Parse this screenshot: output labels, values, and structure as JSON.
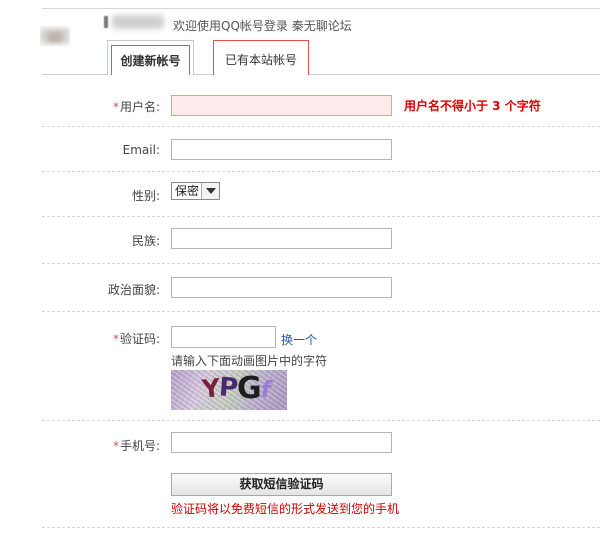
{
  "header": {
    "welcome": "欢迎使用QQ帐号登录 秦无聊论坛"
  },
  "tabs": [
    {
      "label": "创建新帐号",
      "active": true
    },
    {
      "label": "已有本站帐号",
      "active": false
    }
  ],
  "form": {
    "required_mark": "*",
    "username": {
      "label": "用户名:",
      "value": "",
      "error": "用户名不得小于 3 个字符"
    },
    "email": {
      "label": "Email:",
      "value": ""
    },
    "gender": {
      "label": "性别:",
      "selected": "保密"
    },
    "ethnicity": {
      "label": "民族:",
      "value": ""
    },
    "political": {
      "label": "政治面貌:",
      "value": ""
    },
    "captcha": {
      "label": "验证码:",
      "value": "",
      "refresh_link": "换一个",
      "hint": "请输入下面动画图片中的字符",
      "chars": [
        "Y",
        "P",
        "G",
        "f"
      ]
    },
    "phone": {
      "label": "手机号:",
      "value": ""
    },
    "sms_button": "获取短信验证码",
    "sms_note": "验证码将以免费短信的形式发送到您的手机"
  },
  "colors": {
    "required": "#d9534f",
    "error_text": "#e00000",
    "link": "#1f5ea8"
  },
  "icons": {
    "select_arrow": "chevron-down-icon"
  }
}
